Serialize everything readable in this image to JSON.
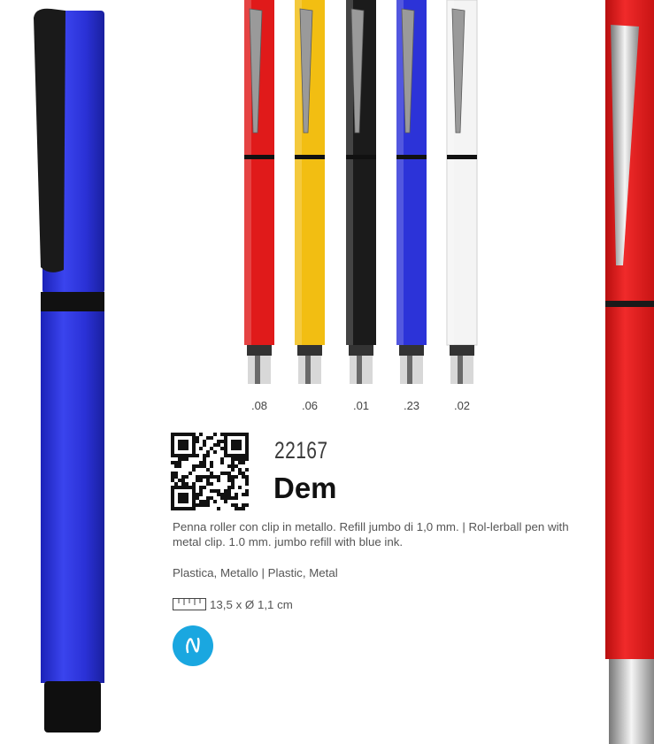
{
  "colors": {
    "blue": "#2c33d8",
    "red": "#e01a1a",
    "yellow": "#f2be12",
    "black": "#1b1b1b",
    "light_blue": "#1f5be8",
    "white": "#f4f4f4",
    "badge": "#1aa7e0"
  },
  "variants": [
    {
      "code": ".08",
      "color": "red"
    },
    {
      "code": ".06",
      "color": "yellow"
    },
    {
      "code": ".01",
      "color": "black"
    },
    {
      "code": ".23",
      "color": "blue"
    },
    {
      "code": ".02",
      "color": "white"
    }
  ],
  "product": {
    "sku": "22167",
    "name": "Dem",
    "description": "Penna roller con clip in metallo. Refill jumbo di 1,0 mm. | Rol-lerball pen with metal clip. 1.0 mm. jumbo refill with blue ink.",
    "material": "Plastica, Metallo | Plastic, Metal",
    "size": "13,5 x Ø 1,1 cm"
  },
  "icons": {
    "qr": "qr-code-icon",
    "ruler": "ruler-icon",
    "badge": "ink-badge-icon"
  }
}
